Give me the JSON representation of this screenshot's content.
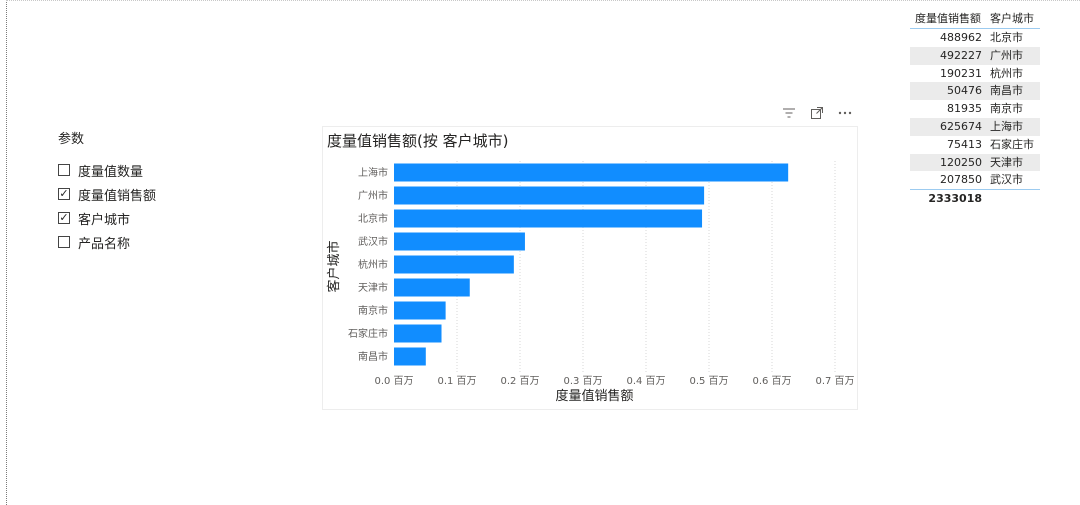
{
  "slicer": {
    "title": "参数",
    "items": [
      {
        "label": "度量值数量",
        "checked": false
      },
      {
        "label": "度量值销售额",
        "checked": true
      },
      {
        "label": "客户城市",
        "checked": true
      },
      {
        "label": "产品名称",
        "checked": false
      }
    ]
  },
  "table": {
    "headers": [
      "度量值销售额",
      "客户城市"
    ],
    "rows": [
      {
        "value": "488962",
        "city": "北京市"
      },
      {
        "value": "492227",
        "city": "广州市"
      },
      {
        "value": "190231",
        "city": "杭州市"
      },
      {
        "value": "50476",
        "city": "南昌市"
      },
      {
        "value": "81935",
        "city": "南京市"
      },
      {
        "value": "625674",
        "city": "上海市"
      },
      {
        "value": "75413",
        "city": "石家庄市"
      },
      {
        "value": "120250",
        "city": "天津市"
      },
      {
        "value": "207850",
        "city": "武汉市"
      }
    ],
    "total": "2333018"
  },
  "chart_icons": [
    "filter-icon",
    "focus-mode-icon",
    "more-options-icon"
  ],
  "chart_data": {
    "type": "bar",
    "orientation": "horizontal",
    "title": "度量值销售额(按 客户城市)",
    "xlabel": "度量值销售额",
    "ylabel": "客户城市",
    "categories": [
      "上海市",
      "广州市",
      "北京市",
      "武汉市",
      "杭州市",
      "天津市",
      "南京市",
      "石家庄市",
      "南昌市"
    ],
    "values": [
      625674,
      492227,
      488962,
      207850,
      190231,
      120250,
      81935,
      75413,
      50476
    ],
    "xlim": [
      0,
      700000
    ],
    "xticks": [
      {
        "value": 0,
        "label": "0.0 百万"
      },
      {
        "value": 100000,
        "label": "0.1 百万"
      },
      {
        "value": 200000,
        "label": "0.2 百万"
      },
      {
        "value": 300000,
        "label": "0.3 百万"
      },
      {
        "value": 400000,
        "label": "0.4 百万"
      },
      {
        "value": 500000,
        "label": "0.5 百万"
      },
      {
        "value": 600000,
        "label": "0.6 百万"
      },
      {
        "value": 700000,
        "label": "0.7 百万"
      }
    ],
    "bar_color": "#118dff",
    "grid": "vertical-dotted"
  }
}
